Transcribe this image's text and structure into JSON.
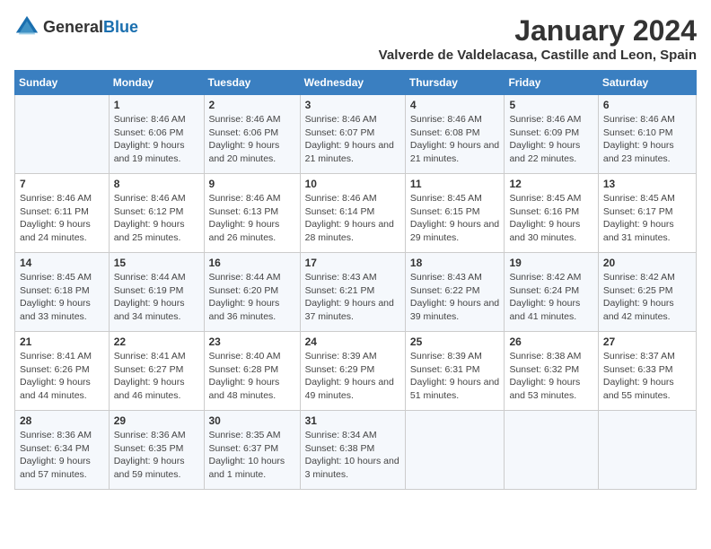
{
  "logo": {
    "text_general": "General",
    "text_blue": "Blue"
  },
  "title": {
    "month_year": "January 2024",
    "location": "Valverde de Valdelacasa, Castille and Leon, Spain"
  },
  "weekdays": [
    "Sunday",
    "Monday",
    "Tuesday",
    "Wednesday",
    "Thursday",
    "Friday",
    "Saturday"
  ],
  "weeks": [
    [
      {
        "day": "",
        "sunrise": "",
        "sunset": "",
        "daylight": ""
      },
      {
        "day": "1",
        "sunrise": "Sunrise: 8:46 AM",
        "sunset": "Sunset: 6:06 PM",
        "daylight": "Daylight: 9 hours and 19 minutes."
      },
      {
        "day": "2",
        "sunrise": "Sunrise: 8:46 AM",
        "sunset": "Sunset: 6:06 PM",
        "daylight": "Daylight: 9 hours and 20 minutes."
      },
      {
        "day": "3",
        "sunrise": "Sunrise: 8:46 AM",
        "sunset": "Sunset: 6:07 PM",
        "daylight": "Daylight: 9 hours and 21 minutes."
      },
      {
        "day": "4",
        "sunrise": "Sunrise: 8:46 AM",
        "sunset": "Sunset: 6:08 PM",
        "daylight": "Daylight: 9 hours and 21 minutes."
      },
      {
        "day": "5",
        "sunrise": "Sunrise: 8:46 AM",
        "sunset": "Sunset: 6:09 PM",
        "daylight": "Daylight: 9 hours and 22 minutes."
      },
      {
        "day": "6",
        "sunrise": "Sunrise: 8:46 AM",
        "sunset": "Sunset: 6:10 PM",
        "daylight": "Daylight: 9 hours and 23 minutes."
      }
    ],
    [
      {
        "day": "7",
        "sunrise": "Sunrise: 8:46 AM",
        "sunset": "Sunset: 6:11 PM",
        "daylight": "Daylight: 9 hours and 24 minutes."
      },
      {
        "day": "8",
        "sunrise": "Sunrise: 8:46 AM",
        "sunset": "Sunset: 6:12 PM",
        "daylight": "Daylight: 9 hours and 25 minutes."
      },
      {
        "day": "9",
        "sunrise": "Sunrise: 8:46 AM",
        "sunset": "Sunset: 6:13 PM",
        "daylight": "Daylight: 9 hours and 26 minutes."
      },
      {
        "day": "10",
        "sunrise": "Sunrise: 8:46 AM",
        "sunset": "Sunset: 6:14 PM",
        "daylight": "Daylight: 9 hours and 28 minutes."
      },
      {
        "day": "11",
        "sunrise": "Sunrise: 8:45 AM",
        "sunset": "Sunset: 6:15 PM",
        "daylight": "Daylight: 9 hours and 29 minutes."
      },
      {
        "day": "12",
        "sunrise": "Sunrise: 8:45 AM",
        "sunset": "Sunset: 6:16 PM",
        "daylight": "Daylight: 9 hours and 30 minutes."
      },
      {
        "day": "13",
        "sunrise": "Sunrise: 8:45 AM",
        "sunset": "Sunset: 6:17 PM",
        "daylight": "Daylight: 9 hours and 31 minutes."
      }
    ],
    [
      {
        "day": "14",
        "sunrise": "Sunrise: 8:45 AM",
        "sunset": "Sunset: 6:18 PM",
        "daylight": "Daylight: 9 hours and 33 minutes."
      },
      {
        "day": "15",
        "sunrise": "Sunrise: 8:44 AM",
        "sunset": "Sunset: 6:19 PM",
        "daylight": "Daylight: 9 hours and 34 minutes."
      },
      {
        "day": "16",
        "sunrise": "Sunrise: 8:44 AM",
        "sunset": "Sunset: 6:20 PM",
        "daylight": "Daylight: 9 hours and 36 minutes."
      },
      {
        "day": "17",
        "sunrise": "Sunrise: 8:43 AM",
        "sunset": "Sunset: 6:21 PM",
        "daylight": "Daylight: 9 hours and 37 minutes."
      },
      {
        "day": "18",
        "sunrise": "Sunrise: 8:43 AM",
        "sunset": "Sunset: 6:22 PM",
        "daylight": "Daylight: 9 hours and 39 minutes."
      },
      {
        "day": "19",
        "sunrise": "Sunrise: 8:42 AM",
        "sunset": "Sunset: 6:24 PM",
        "daylight": "Daylight: 9 hours and 41 minutes."
      },
      {
        "day": "20",
        "sunrise": "Sunrise: 8:42 AM",
        "sunset": "Sunset: 6:25 PM",
        "daylight": "Daylight: 9 hours and 42 minutes."
      }
    ],
    [
      {
        "day": "21",
        "sunrise": "Sunrise: 8:41 AM",
        "sunset": "Sunset: 6:26 PM",
        "daylight": "Daylight: 9 hours and 44 minutes."
      },
      {
        "day": "22",
        "sunrise": "Sunrise: 8:41 AM",
        "sunset": "Sunset: 6:27 PM",
        "daylight": "Daylight: 9 hours and 46 minutes."
      },
      {
        "day": "23",
        "sunrise": "Sunrise: 8:40 AM",
        "sunset": "Sunset: 6:28 PM",
        "daylight": "Daylight: 9 hours and 48 minutes."
      },
      {
        "day": "24",
        "sunrise": "Sunrise: 8:39 AM",
        "sunset": "Sunset: 6:29 PM",
        "daylight": "Daylight: 9 hours and 49 minutes."
      },
      {
        "day": "25",
        "sunrise": "Sunrise: 8:39 AM",
        "sunset": "Sunset: 6:31 PM",
        "daylight": "Daylight: 9 hours and 51 minutes."
      },
      {
        "day": "26",
        "sunrise": "Sunrise: 8:38 AM",
        "sunset": "Sunset: 6:32 PM",
        "daylight": "Daylight: 9 hours and 53 minutes."
      },
      {
        "day": "27",
        "sunrise": "Sunrise: 8:37 AM",
        "sunset": "Sunset: 6:33 PM",
        "daylight": "Daylight: 9 hours and 55 minutes."
      }
    ],
    [
      {
        "day": "28",
        "sunrise": "Sunrise: 8:36 AM",
        "sunset": "Sunset: 6:34 PM",
        "daylight": "Daylight: 9 hours and 57 minutes."
      },
      {
        "day": "29",
        "sunrise": "Sunrise: 8:36 AM",
        "sunset": "Sunset: 6:35 PM",
        "daylight": "Daylight: 9 hours and 59 minutes."
      },
      {
        "day": "30",
        "sunrise": "Sunrise: 8:35 AM",
        "sunset": "Sunset: 6:37 PM",
        "daylight": "Daylight: 10 hours and 1 minute."
      },
      {
        "day": "31",
        "sunrise": "Sunrise: 8:34 AM",
        "sunset": "Sunset: 6:38 PM",
        "daylight": "Daylight: 10 hours and 3 minutes."
      },
      {
        "day": "",
        "sunrise": "",
        "sunset": "",
        "daylight": ""
      },
      {
        "day": "",
        "sunrise": "",
        "sunset": "",
        "daylight": ""
      },
      {
        "day": "",
        "sunrise": "",
        "sunset": "",
        "daylight": ""
      }
    ]
  ]
}
